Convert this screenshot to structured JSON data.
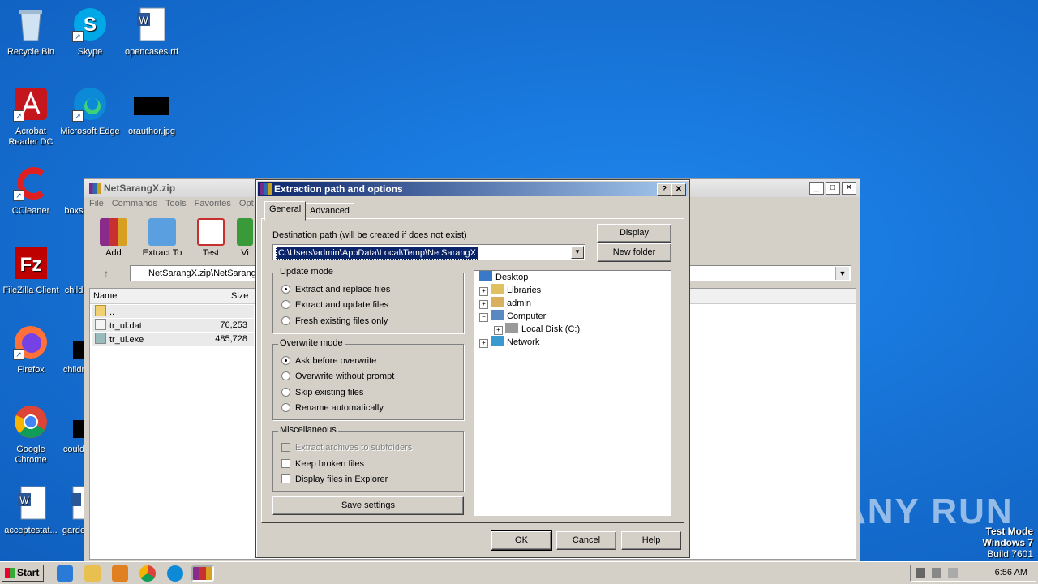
{
  "desktop": {
    "icons": [
      {
        "label": "Recycle Bin",
        "icon": "recycle-bin-icon"
      },
      {
        "label": "Skype",
        "icon": "skype-icon"
      },
      {
        "label": "opencases.rtf",
        "icon": "word-doc-icon"
      },
      {
        "label": "Acrobat Reader DC",
        "icon": "acrobat-icon"
      },
      {
        "label": "Microsoft Edge",
        "icon": "edge-icon"
      },
      {
        "label": "orauthor.jpg",
        "icon": "image-thumb-icon"
      },
      {
        "label": "CCleaner",
        "icon": "ccleaner-icon"
      },
      {
        "label": "boxs",
        "icon": "file-icon"
      },
      {
        "label": "FileZilla Client",
        "icon": "filezilla-icon"
      },
      {
        "label": "child",
        "icon": "file-icon"
      },
      {
        "label": "Firefox",
        "icon": "firefox-icon"
      },
      {
        "label": "childr",
        "icon": "file-icon"
      },
      {
        "label": "Google Chrome",
        "icon": "chrome-icon"
      },
      {
        "label": "could",
        "icon": "file-icon"
      },
      {
        "label": "acceptestat...",
        "icon": "word-doc-icon"
      },
      {
        "label": "garde",
        "icon": "word-doc-icon"
      }
    ],
    "watermark": "ANY RUN",
    "test_mode": [
      "Test Mode",
      "Windows 7",
      "Build 7601"
    ]
  },
  "winrar": {
    "title": "NetSarangX.zip",
    "menu": [
      "File",
      "Commands",
      "Tools",
      "Favorites",
      "Opt"
    ],
    "toolbar": [
      "Add",
      "Extract To",
      "Test",
      "Vi"
    ],
    "address": "NetSarangX.zip\\NetSarangX",
    "columns": {
      "name": "Name",
      "size": "Size"
    },
    "files": [
      {
        "name": "..",
        "size": ""
      },
      {
        "name": "tr_ul.dat",
        "size": "76,253"
      },
      {
        "name": "tr_ul.exe",
        "size": "485,728"
      }
    ]
  },
  "dialog": {
    "title": "Extraction path and options",
    "title_help": "?",
    "title_close": "✕",
    "tabs": [
      "General",
      "Advanced"
    ],
    "dest_label": "Destination path (will be created if does not exist)",
    "dest_value": "C:\\Users\\admin\\AppData\\Local\\Temp\\NetSarangX",
    "display_btn": "Display",
    "new_folder_btn": "New folder",
    "update_mode": {
      "label": "Update mode",
      "options": [
        "Extract and replace files",
        "Extract and update files",
        "Fresh existing files only"
      ],
      "selected": 0
    },
    "overwrite_mode": {
      "label": "Overwrite mode",
      "options": [
        "Ask before overwrite",
        "Overwrite without prompt",
        "Skip existing files",
        "Rename automatically"
      ],
      "selected": 0
    },
    "misc": {
      "label": "Miscellaneous",
      "options": [
        "Extract archives to subfolders",
        "Keep broken files",
        "Display files in Explorer"
      ]
    },
    "save_settings": "Save settings",
    "tree": [
      "Desktop",
      "Libraries",
      "admin",
      "Computer",
      "Local Disk (C:)",
      "Network"
    ],
    "ok": "OK",
    "cancel": "Cancel",
    "help": "Help"
  },
  "taskbar": {
    "start": "Start",
    "clock": "6:56 AM"
  }
}
